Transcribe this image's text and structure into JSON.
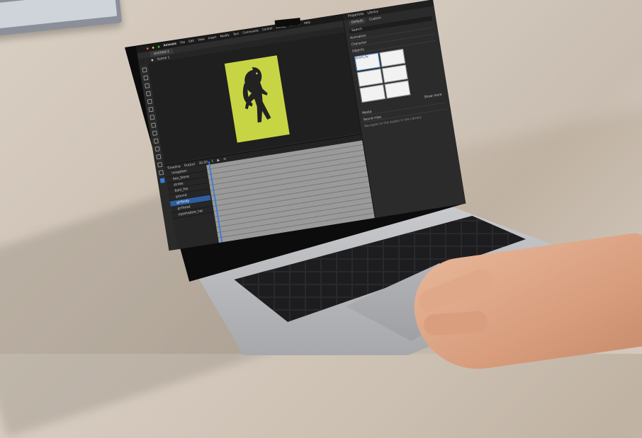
{
  "app": {
    "name": "Animate",
    "menu": [
      "File",
      "Edit",
      "View",
      "Insert",
      "Modify",
      "Text",
      "Commands",
      "Control",
      "Debug",
      "Window",
      "Help"
    ],
    "document_tab": "Untitled-1",
    "scene_label": "Scene 1"
  },
  "panel": {
    "tabs": [
      "Properties",
      "Library"
    ],
    "workspace_buttons": [
      "Default",
      "Custom"
    ],
    "search_placeholder": "Search",
    "sections": [
      "Animation",
      "Character",
      "Objects"
    ],
    "selected_asset": "Simplify_Bg",
    "show_more": "Show more",
    "bottom_items": [
      "Media",
      "Sound clips"
    ],
    "footer_text": "Navigate to the assets in the Library"
  },
  "timeline": {
    "tabs": [
      "Timeline",
      "Output"
    ],
    "fps": "30.00",
    "frame": "1",
    "layers": [
      "Imagebar",
      "Sea_Stone",
      "stroke",
      "Bald_Pat",
      "ground",
      "girlbody",
      "girlhead",
      "eyeshadow_hat"
    ],
    "active_layer": "girlbody"
  },
  "colors": {
    "artboard": "#c7d544",
    "ui_dark": "#252526",
    "accent": "#3a7bd5"
  }
}
